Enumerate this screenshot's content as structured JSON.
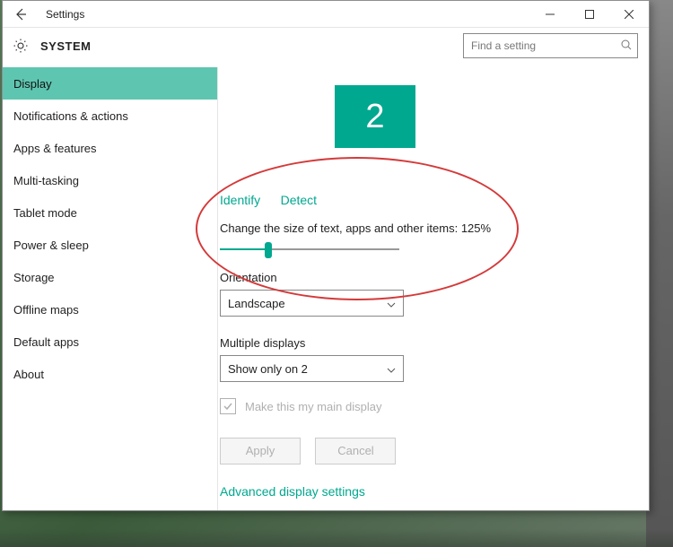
{
  "titlebar": {
    "title": "Settings"
  },
  "header": {
    "title": "SYSTEM",
    "search_placeholder": "Find a setting"
  },
  "sidebar": {
    "items": [
      {
        "label": "Display",
        "selected": true
      },
      {
        "label": "Notifications & actions"
      },
      {
        "label": "Apps & features"
      },
      {
        "label": "Multi-tasking"
      },
      {
        "label": "Tablet mode"
      },
      {
        "label": "Power & sleep"
      },
      {
        "label": "Storage"
      },
      {
        "label": "Offline maps"
      },
      {
        "label": "Default apps"
      },
      {
        "label": "About"
      }
    ]
  },
  "content": {
    "monitor_number": "2",
    "identify_link": "Identify",
    "detect_link": "Detect",
    "scale_label": "Change the size of text, apps and other items: 125%",
    "orientation_label": "Orientation",
    "orientation_value": "Landscape",
    "multiple_displays_label": "Multiple displays",
    "multiple_displays_value": "Show only on 2",
    "main_display_label": "Make this my main display",
    "apply_btn": "Apply",
    "cancel_btn": "Cancel",
    "advanced_link": "Advanced display settings"
  }
}
